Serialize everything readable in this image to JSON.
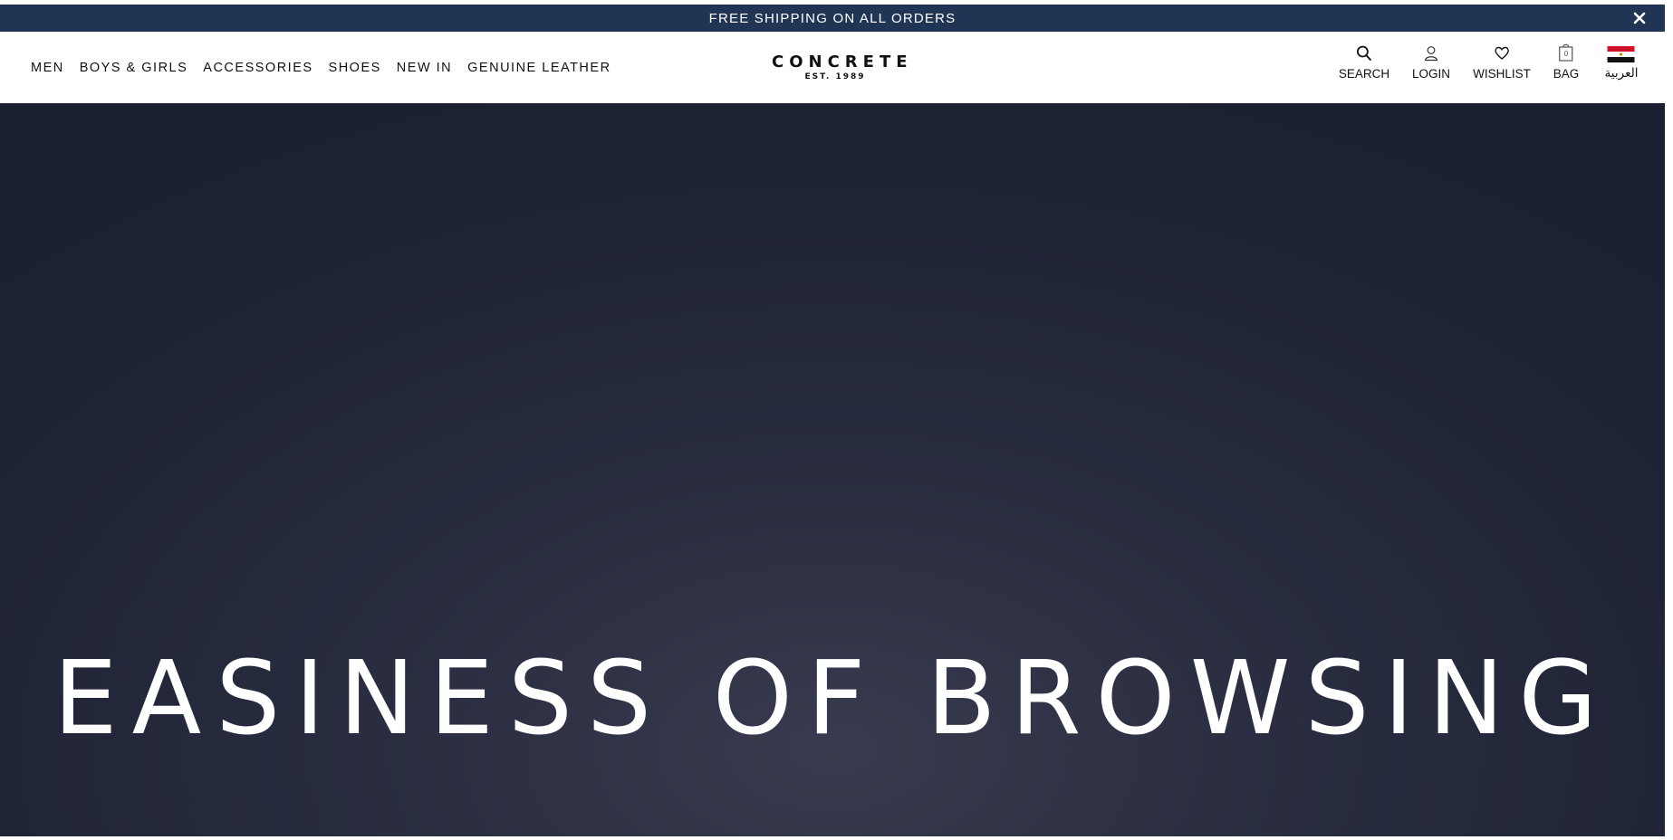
{
  "announcement": {
    "text": "FREE SHIPPING ON ALL ORDERS",
    "close_icon": "close-icon",
    "background": "#1f3553"
  },
  "nav": {
    "items": [
      {
        "label": "MEN"
      },
      {
        "label": "BOYS & GIRLS"
      },
      {
        "label": "ACCESSORIES"
      },
      {
        "label": "SHOES"
      },
      {
        "label": "NEW IN"
      },
      {
        "label": "GENUINE LEATHER"
      }
    ]
  },
  "logo": {
    "name": "CONCRETE",
    "tagline": "EST. 1989"
  },
  "utilities": {
    "search": {
      "label": "SEARCH",
      "icon": "search-icon"
    },
    "login": {
      "label": "LOGIN",
      "icon": "user-icon"
    },
    "wishlist": {
      "label": "WISHLIST",
      "icon": "heart-icon"
    },
    "bag": {
      "label": "BAG",
      "icon": "bag-icon",
      "count": "0"
    },
    "language": {
      "label": "العربية",
      "icon": "egypt-flag-icon"
    }
  },
  "hero": {
    "title": "EASINESS OF BROWSING",
    "background": "#262a3d"
  }
}
